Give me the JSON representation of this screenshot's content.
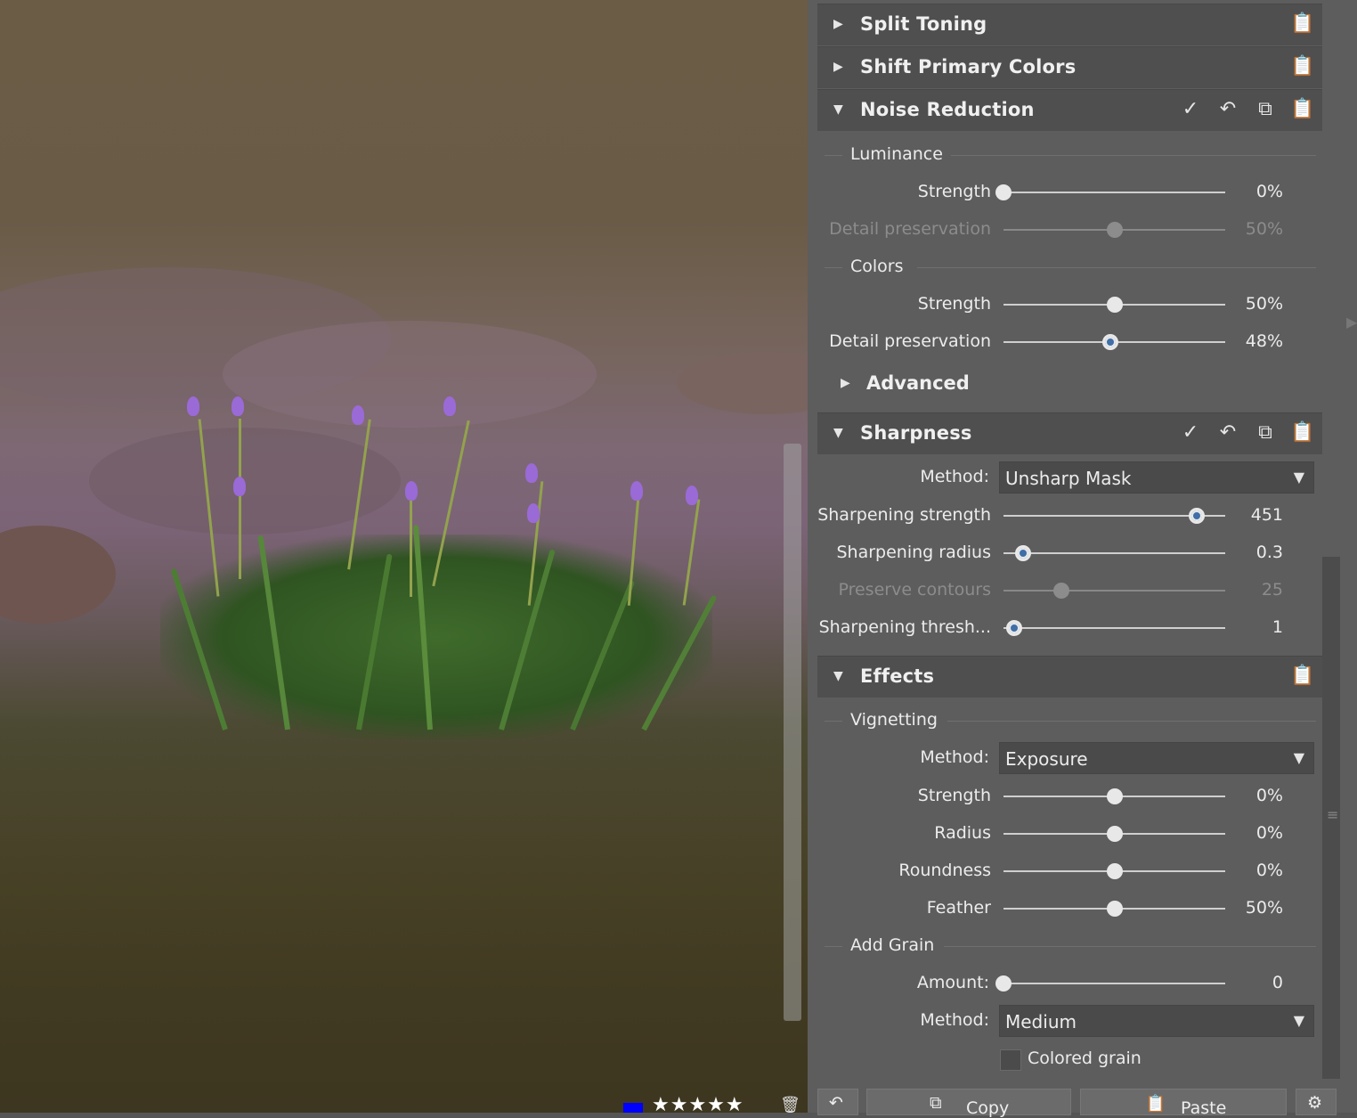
{
  "sections": {
    "split_toning": {
      "title": "Split Toning"
    },
    "shift_primary": {
      "title": "Shift Primary Colors"
    },
    "noise_reduction": {
      "title": "Noise Reduction",
      "luminance": {
        "label": "Luminance",
        "strength": {
          "label": "Strength",
          "value": "0%",
          "level": 0.0
        },
        "detail": {
          "label": "Detail preservation",
          "value": "50%",
          "level": 0.5
        }
      },
      "colors": {
        "label": "Colors",
        "strength": {
          "label": "Strength",
          "value": "50%",
          "level": 0.5
        },
        "detail": {
          "label": "Detail preservation",
          "value": "48%",
          "level": 0.48
        }
      },
      "advanced": {
        "title": "Advanced"
      }
    },
    "sharpness": {
      "title": "Sharpness",
      "method": {
        "label": "Method:",
        "value": "Unsharp Mask"
      },
      "strength": {
        "label": "Sharpening strength",
        "value": "451",
        "level": 0.87
      },
      "radius": {
        "label": "Sharpening radius",
        "value": "0.3",
        "level": 0.09
      },
      "contours": {
        "label": "Preserve contours",
        "value": "25",
        "level": 0.26
      },
      "threshold": {
        "label": "Sharpening thresh...",
        "value": "1",
        "level": 0.05
      }
    },
    "effects": {
      "title": "Effects",
      "vignetting": {
        "label": "Vignetting",
        "method": {
          "label": "Method:",
          "value": "Exposure"
        },
        "strength": {
          "label": "Strength",
          "value": "0%",
          "level": 0.5
        },
        "radius": {
          "label": "Radius",
          "value": "0%",
          "level": 0.5
        },
        "roundness": {
          "label": "Roundness",
          "value": "0%",
          "level": 0.5
        },
        "feather": {
          "label": "Feather",
          "value": "50%",
          "level": 0.5
        }
      },
      "grain": {
        "label": "Add Grain",
        "amount": {
          "label": "Amount:",
          "value": "0",
          "level": 0.0
        },
        "method": {
          "label": "Method:",
          "value": "Medium"
        },
        "colored": {
          "label": "Colored grain"
        }
      }
    }
  },
  "bottom_bar": {
    "copy_label": "Copy",
    "paste_label": "Paste"
  },
  "photo": {
    "stars": "★★★★★",
    "label_color": "#0000ff"
  },
  "icons": {
    "check": "✓",
    "reset": "↶",
    "copy": "⧉",
    "paste": "📋",
    "trash": "🗑",
    "tri_right": "▶",
    "tri_down": "▼",
    "dropdown": "▼"
  },
  "colors": {
    "panel_bg": "#5d5d5d",
    "header_bg": "#4f4f4f",
    "accent_thumb": "#3f6ea8"
  }
}
